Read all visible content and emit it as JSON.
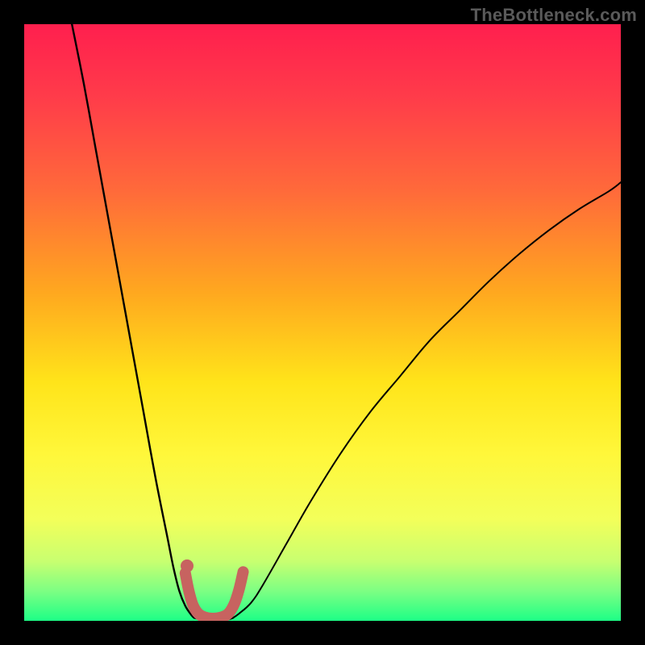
{
  "watermark": "TheBottleneck.com",
  "colors": {
    "frame_bg": "#000000",
    "gradient_stops": [
      {
        "offset": 0.0,
        "color": "#ff1f4e"
      },
      {
        "offset": 0.12,
        "color": "#ff3b4a"
      },
      {
        "offset": 0.28,
        "color": "#ff6a3a"
      },
      {
        "offset": 0.45,
        "color": "#ffa81f"
      },
      {
        "offset": 0.6,
        "color": "#ffe41a"
      },
      {
        "offset": 0.72,
        "color": "#fff73a"
      },
      {
        "offset": 0.83,
        "color": "#f3ff5a"
      },
      {
        "offset": 0.9,
        "color": "#c8ff70"
      },
      {
        "offset": 0.95,
        "color": "#7dff83"
      },
      {
        "offset": 1.0,
        "color": "#1dff86"
      }
    ],
    "curve": "#000000",
    "marker_stroke": "#c76360",
    "marker_fill": "#c76360"
  },
  "chart_data": {
    "type": "line",
    "title": "",
    "xlabel": "",
    "ylabel": "",
    "xlim": [
      0,
      100
    ],
    "ylim": [
      0,
      100
    ],
    "series": [
      {
        "name": "left-branch",
        "x": [
          8,
          10,
          12,
          14,
          16,
          18,
          20,
          22,
          24,
          25,
          26,
          27,
          28,
          28.5
        ],
        "y": [
          100,
          90,
          79,
          68,
          57,
          46,
          35,
          24,
          14,
          9,
          5,
          2.5,
          1,
          0.5
        ]
      },
      {
        "name": "right-branch",
        "x": [
          35,
          36,
          38,
          40,
          44,
          48,
          53,
          58,
          63,
          68,
          73,
          78,
          83,
          88,
          93,
          98,
          100
        ],
        "y": [
          0.5,
          1.2,
          3,
          6,
          13,
          20,
          28,
          35,
          41,
          47,
          52,
          57,
          61.5,
          65.5,
          69,
          72,
          73.5
        ]
      },
      {
        "name": "valley-floor",
        "x": [
          28.5,
          30,
          32,
          34,
          35
        ],
        "y": [
          0.5,
          0.2,
          0.15,
          0.2,
          0.5
        ]
      }
    ],
    "markers": {
      "name": "highlight-valley",
      "dot": {
        "x": 27.3,
        "y": 9.2
      },
      "u_path": [
        {
          "x": 27.0,
          "y": 8.0
        },
        {
          "x": 27.6,
          "y": 5.0
        },
        {
          "x": 28.3,
          "y": 2.6
        },
        {
          "x": 29.2,
          "y": 1.2
        },
        {
          "x": 30.3,
          "y": 0.6
        },
        {
          "x": 31.6,
          "y": 0.4
        },
        {
          "x": 33.0,
          "y": 0.6
        },
        {
          "x": 34.2,
          "y": 1.2
        },
        {
          "x": 35.2,
          "y": 2.8
        },
        {
          "x": 36.0,
          "y": 5.2
        },
        {
          "x": 36.7,
          "y": 8.2
        }
      ]
    }
  }
}
